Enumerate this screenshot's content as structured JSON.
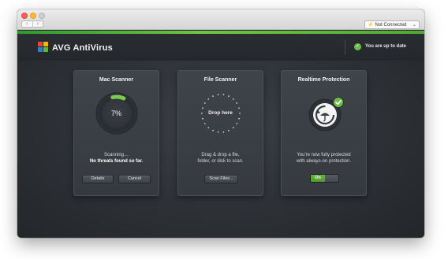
{
  "titlebar": {
    "nav_back": "‹",
    "nav_forward": "›",
    "connection_status": "Not Connected"
  },
  "header": {
    "app_name": "AVG AntiVirus",
    "status_text": "You are up to date"
  },
  "cards": {
    "mac_scanner": {
      "title": "Mac Scanner",
      "progress_label": "7%",
      "progress_value": 0.07,
      "status_line1": "Scanning…",
      "status_line2": "No threats found so far.",
      "details_button": "Details",
      "cancel_button": "Cancel"
    },
    "file_scanner": {
      "title": "File Scanner",
      "drop_label": "Drop here",
      "desc_line1": "Drag & drop a file,",
      "desc_line2": "folder, or disk to scan.",
      "scan_button": "Scan Files..."
    },
    "realtime": {
      "title": "Realtime Protection",
      "desc_line1": "You're now fully protected",
      "desc_line2": "with always-on protection.",
      "toggle_label": "On"
    }
  },
  "colors": {
    "accent_green": "#6bbd45",
    "window_bg": "#2b2e33"
  }
}
